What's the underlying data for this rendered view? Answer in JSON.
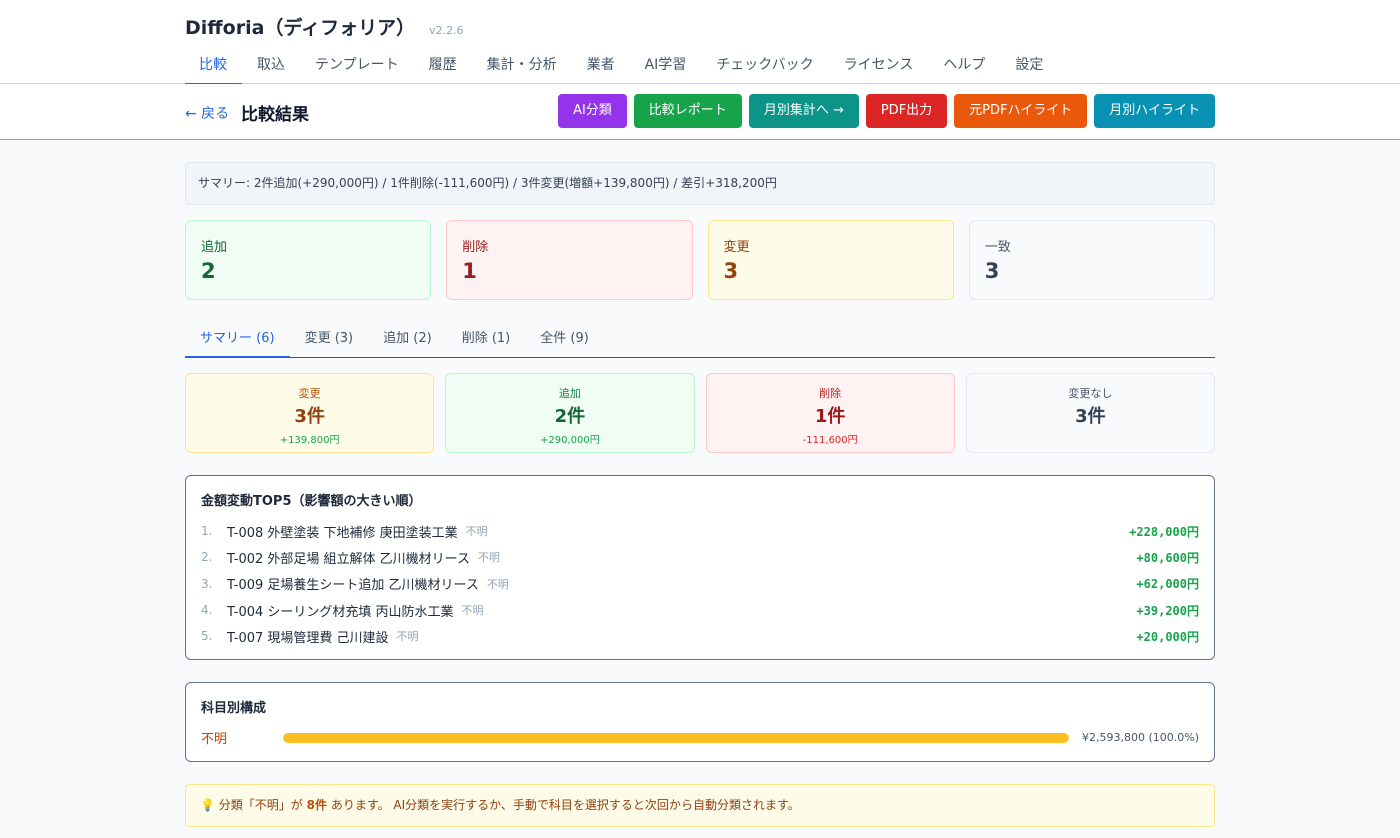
{
  "app": {
    "title": "Difforia（ディフォリア）",
    "version": "v2.2.6"
  },
  "nav": [
    {
      "label": "比較",
      "active": true
    },
    {
      "label": "取込"
    },
    {
      "label": "テンプレート"
    },
    {
      "label": "履歴"
    },
    {
      "label": "集計・分析"
    },
    {
      "label": "業者"
    },
    {
      "label": "AI学習"
    },
    {
      "label": "チェックバック"
    },
    {
      "label": "ライセンス"
    },
    {
      "label": "ヘルプ"
    },
    {
      "label": "設定"
    }
  ],
  "toolbar": {
    "back": "← 戻る",
    "title": "比較結果",
    "buttons": {
      "ai": "AI分類",
      "report": "比較レポート",
      "monthly": "月別集計へ →",
      "pdf": "PDF出力",
      "orig": "元PDFハイライト",
      "month_highlight": "月別ハイライト"
    }
  },
  "summary_text": "サマリー: 2件追加(+290,000円) / 1件削除(-111,600円) / 3件変更(増額+139,800円) / 差引+318,200円",
  "stats": {
    "added": {
      "label": "追加",
      "value": "2"
    },
    "deleted": {
      "label": "削除",
      "value": "1"
    },
    "changed": {
      "label": "変更",
      "value": "3"
    },
    "matched": {
      "label": "一致",
      "value": "3"
    }
  },
  "tabs": [
    {
      "label": "サマリー (6)",
      "active": true
    },
    {
      "label": "変更 (3)"
    },
    {
      "label": "追加 (2)"
    },
    {
      "label": "削除 (1)"
    },
    {
      "label": "全件 (9)"
    }
  ],
  "summary_cards": {
    "changed": {
      "label": "変更",
      "count": "3件",
      "amount": "+139,800円"
    },
    "added": {
      "label": "追加",
      "count": "2件",
      "amount": "+290,000円"
    },
    "deleted": {
      "label": "削除",
      "count": "1件",
      "amount": "-111,600円"
    },
    "unchanged": {
      "label": "変更なし",
      "count": "3件"
    }
  },
  "top5": {
    "title": "金額変動TOP5（影響額の大きい順）",
    "items": [
      {
        "rank": "1.",
        "name": "T-008 外壁塗装 下地補修 庚田塗装工業",
        "category": "不明",
        "amount": "+228,000円"
      },
      {
        "rank": "2.",
        "name": "T-002 外部足場 組立解体 乙川機材リース",
        "category": "不明",
        "amount": "+80,600円"
      },
      {
        "rank": "3.",
        "name": "T-009 足場養生シート追加 乙川機材リース",
        "category": "不明",
        "amount": "+62,000円"
      },
      {
        "rank": "4.",
        "name": "T-004 シーリング材充填 丙山防水工業",
        "category": "不明",
        "amount": "+39,200円"
      },
      {
        "rank": "5.",
        "name": "T-007 現場管理費 己川建設",
        "category": "不明",
        "amount": "+20,000円"
      }
    ]
  },
  "composition": {
    "title": "科目別構成",
    "rows": [
      {
        "label": "不明",
        "amount": "¥2,593,800 (100.0%)",
        "share": 1.0
      }
    ]
  },
  "notice": {
    "icon": "lightbulb-icon",
    "prefix": "分類「不明」が",
    "count": "8件",
    "suffix": "あります。 AI分類を実行するか、手動で科目を選択すると次回から自動分類されます。"
  }
}
